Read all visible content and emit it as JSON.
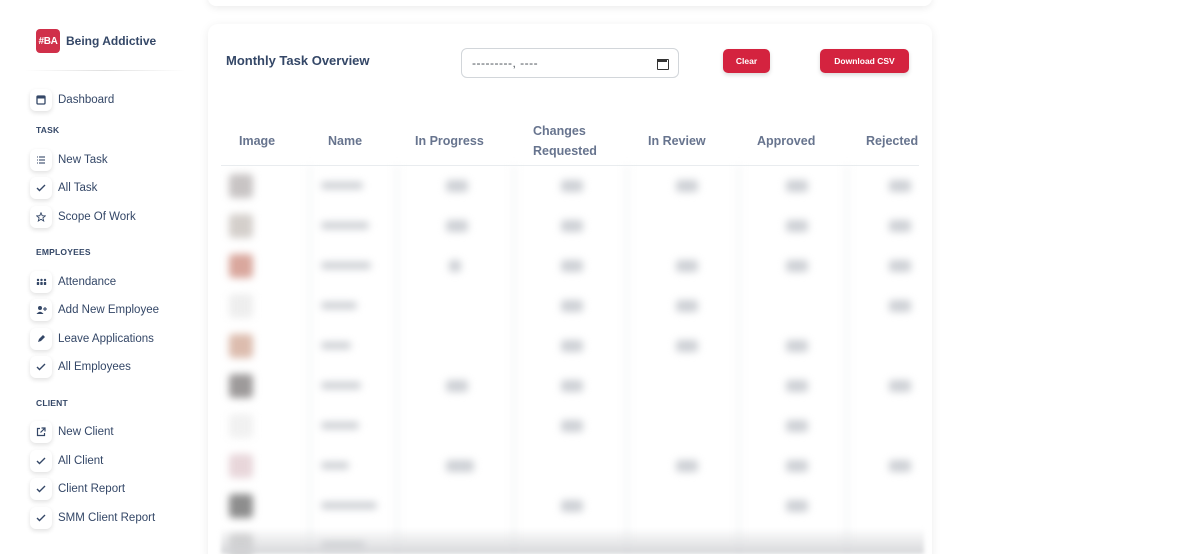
{
  "brand": {
    "logo_text": "#BA",
    "name": "Being Addictive",
    "accent": "#d4233f"
  },
  "sidebar": {
    "dashboard": {
      "label": "Dashboard",
      "icon": "dashboard-icon"
    },
    "sections": [
      {
        "title": "TASK",
        "items": [
          {
            "label": "New Task",
            "icon": "list-icon"
          },
          {
            "label": "All Task",
            "icon": "check-icon"
          },
          {
            "label": "Scope Of Work",
            "icon": "star-icon"
          }
        ]
      },
      {
        "title": "EMPLOYEES",
        "items": [
          {
            "label": "Attendance",
            "icon": "people-icon"
          },
          {
            "label": "Add New Employee",
            "icon": "add-user-icon"
          },
          {
            "label": "Leave Applications",
            "icon": "pen-icon"
          },
          {
            "label": "All Employees",
            "icon": "check-icon"
          }
        ]
      },
      {
        "title": "CLIENT",
        "items": [
          {
            "label": "New Client",
            "icon": "external-link-icon"
          },
          {
            "label": "All Client",
            "icon": "check-icon"
          },
          {
            "label": "Client Report",
            "icon": "check-icon"
          },
          {
            "label": "SMM Client Report",
            "icon": "check-icon"
          }
        ]
      }
    ]
  },
  "main": {
    "title": "Monthly Task Overview",
    "month_input": {
      "value": "---------, ----"
    },
    "buttons": {
      "clear": "Clear",
      "download": "Download CSV"
    },
    "table": {
      "columns": [
        "Image",
        "Name",
        "In Progress",
        "Changes Requested",
        "In Review",
        "Approved",
        "Rejected"
      ]
    }
  }
}
